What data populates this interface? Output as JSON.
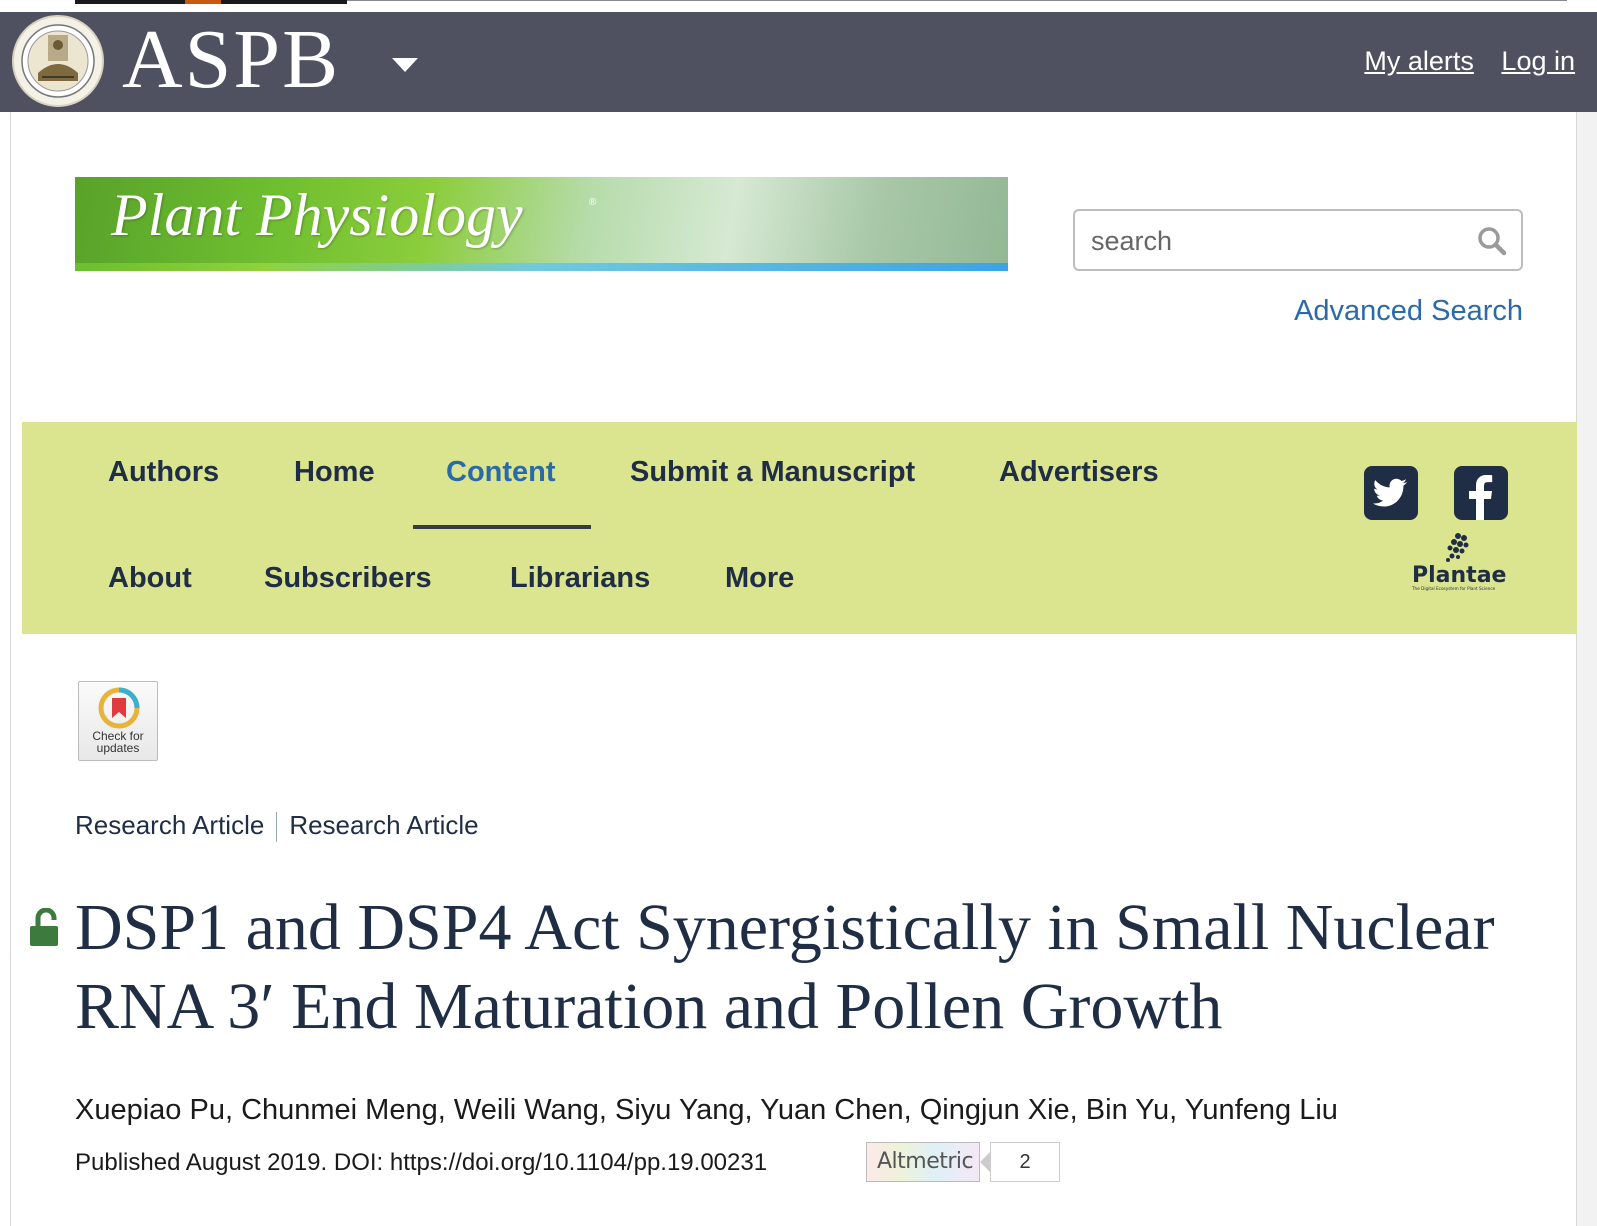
{
  "header": {
    "logo_text": "ASPB",
    "links": [
      "My alerts",
      "Log in"
    ]
  },
  "banner": {
    "journal_title": "Plant Physiology",
    "registered_mark": "®"
  },
  "search": {
    "placeholder": "search",
    "advanced_label": "Advanced Search"
  },
  "nav": {
    "row1": [
      "Authors",
      "Home",
      "Content",
      "Submit a Manuscript",
      "Advertisers"
    ],
    "row2": [
      "About",
      "Subscribers",
      "Librarians",
      "More"
    ],
    "active": "Content",
    "plantae_label": "Plantae",
    "plantae_tagline": "The Digital Ecosystem for Plant Science"
  },
  "check_updates": {
    "line1": "Check for",
    "line2": "updates"
  },
  "breadcrumbs": [
    "Research Article",
    "Research Article"
  ],
  "article": {
    "title": "DSP1 and DSP4 Act Synergistically in Small Nuclear RNA 3′ End Maturation and Pollen Growth",
    "authors": "Xuepiao Pu, Chunmei Meng, Weili Wang, Siyu Yang, Yuan Chen, Qingjun Xie, Bin Yu, Yunfeng Liu",
    "published": "Published August 2019. DOI: https://doi.org/10.1104/pp.19.00231",
    "altmetric_label": "Altmetric",
    "altmetric_score": "2"
  },
  "colors": {
    "header_bg": "#4f5160",
    "nav_bg": "#dbe48e",
    "nav_text": "#1f2d45",
    "link_blue": "#2b6aa8",
    "open_access_green": "#3d7a3d"
  }
}
